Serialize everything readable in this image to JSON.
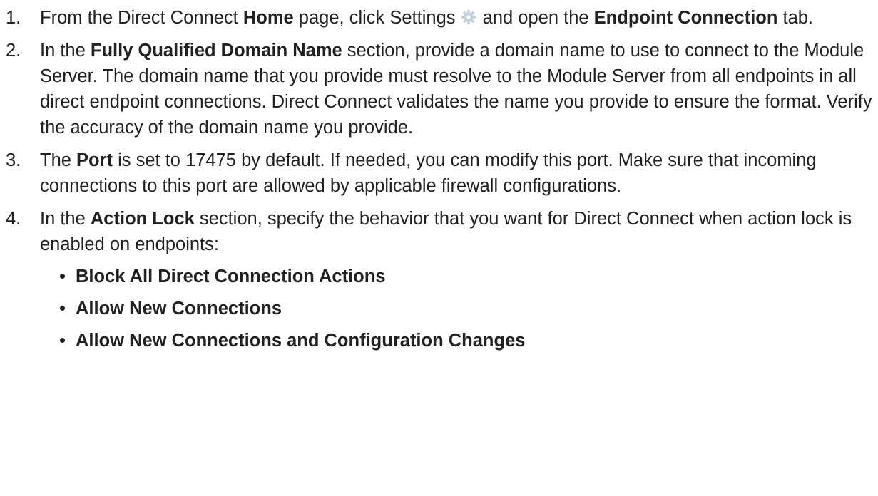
{
  "steps": [
    {
      "num": "1.",
      "parts": {
        "a": "From the Direct Connect ",
        "b": "Home",
        "c": " page, click Settings ",
        "d": " and open the ",
        "e": "Endpoint Connection",
        "f": " tab."
      }
    },
    {
      "num": "2.",
      "parts": {
        "a": "In the ",
        "b": "Fully Qualified Domain Name",
        "c": " section, provide a domain name to use to connect to the Module Server. The domain name that you provide must resolve to the Module Server from all endpoints in all direct endpoint connections. Direct Connect validates the name you provide to ensure the format. Verify the accuracy of the domain name you provide."
      }
    },
    {
      "num": "3.",
      "parts": {
        "a": "The ",
        "b": "Port",
        "c": " is set to 17475 by default. If needed, you can modify this port. Make sure that incoming connections to this port are allowed by applicable firewall configurations."
      }
    },
    {
      "num": "4.",
      "parts": {
        "a": "In the ",
        "b": "Action Lock",
        "c": " section, specify the behavior that you want for Direct Connect when action lock is enabled on endpoints:"
      },
      "options": [
        "Block All Direct Connection Actions",
        "Allow New Connections",
        "Allow New Connections and Configuration Changes"
      ]
    }
  ],
  "icons": {
    "settings": "gear-icon"
  },
  "colors": {
    "text": "#222222",
    "gear": "#c4cfe0"
  }
}
